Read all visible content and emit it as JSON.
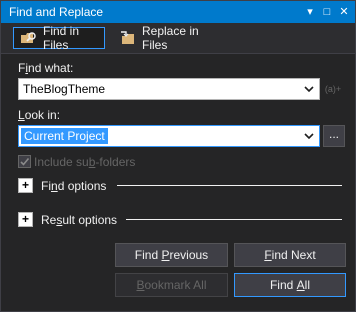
{
  "window": {
    "title": "Find and Replace",
    "controls": {
      "dropdown_glyph": "▾",
      "pin_glyph": "□",
      "close_glyph": "✕"
    }
  },
  "tabs": [
    {
      "label": "Find in Files",
      "icon": "find-in-files-icon",
      "active": true
    },
    {
      "label": "Replace in Files",
      "icon": "replace-in-files-icon",
      "active": false
    }
  ],
  "find_what": {
    "label_prefix": "F",
    "label_underlined": "i",
    "label_suffix": "nd what:",
    "value": "TheBlogTheme",
    "regex_label": "(a)+"
  },
  "look_in": {
    "label_prefix": "",
    "label_underlined": "L",
    "label_suffix": "ook in:",
    "value": "Current Project",
    "browse_label": "..."
  },
  "include_subfolders": {
    "label_prefix": "Include su",
    "label_underlined": "b",
    "label_suffix": "-folders",
    "checked": true,
    "enabled": false
  },
  "find_options": {
    "expander": "+",
    "label_prefix": "Fi",
    "label_underlined": "n",
    "label_suffix": "d options"
  },
  "result_options": {
    "expander": "+",
    "label_prefix": "Re",
    "label_underlined": "s",
    "label_suffix": "ult options"
  },
  "buttons": {
    "find_previous": {
      "prefix": "Find ",
      "underlined": "P",
      "suffix": "revious"
    },
    "find_next": {
      "prefix": "",
      "underlined": "F",
      "suffix": "ind Next"
    },
    "bookmark_all": {
      "prefix": "",
      "underlined": "B",
      "suffix": "ookmark All"
    },
    "find_all": {
      "prefix": "Find ",
      "underlined": "A",
      "suffix": "ll"
    }
  },
  "colors": {
    "accent": "#007acc",
    "selection": "#3399ff",
    "background": "#252526",
    "button": "#3f3f46",
    "disabled_text": "#656565"
  }
}
